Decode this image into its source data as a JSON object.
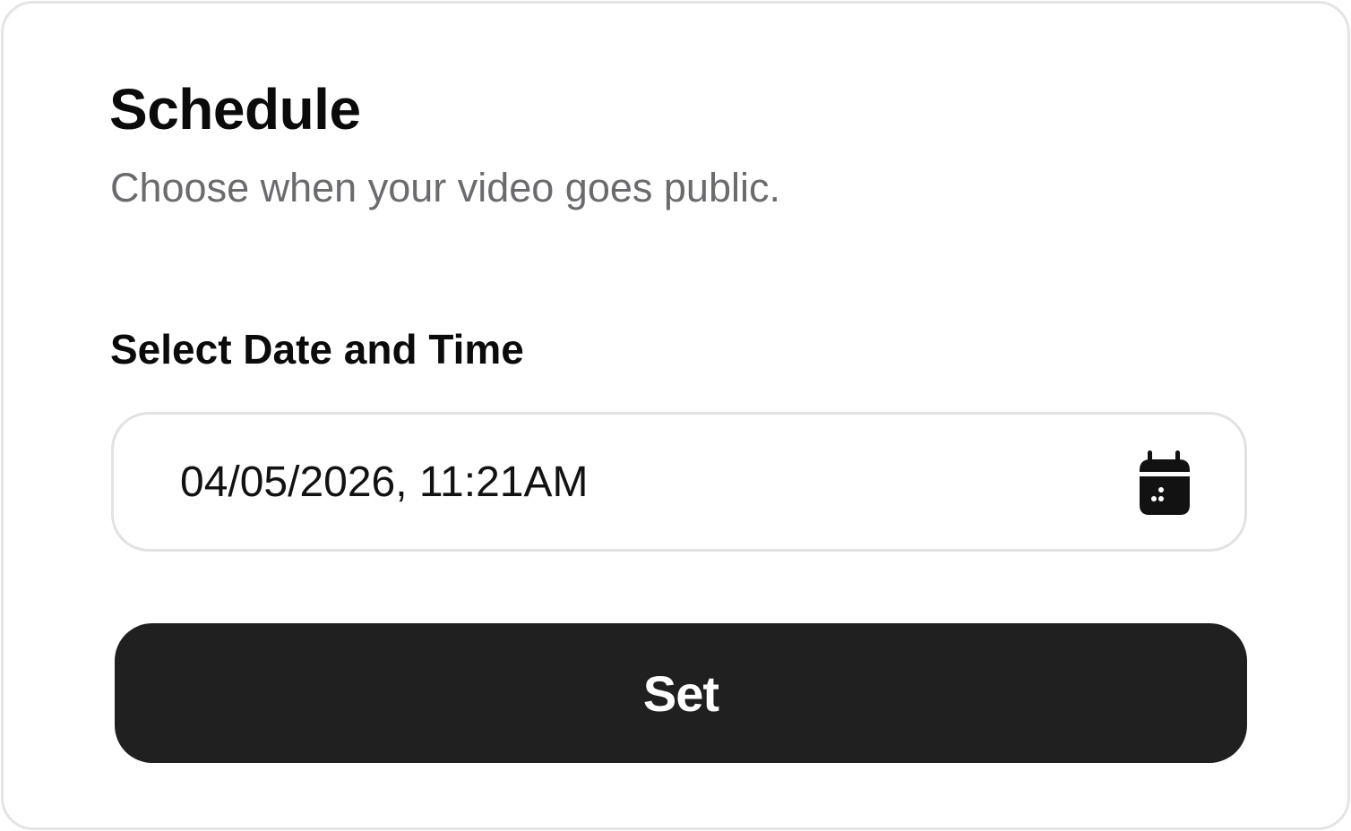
{
  "dialog": {
    "title": "Schedule",
    "subtitle": "Choose when your video goes public."
  },
  "field": {
    "label": "Select Date and Time",
    "value": "04/05/2026, 11:21AM",
    "icon": "calendar-icon"
  },
  "actions": {
    "set_label": "Set"
  },
  "colors": {
    "button_bg": "#202020",
    "button_text": "#ffffff",
    "border": "#e4e4e6",
    "muted_text": "#6b6b6e"
  }
}
